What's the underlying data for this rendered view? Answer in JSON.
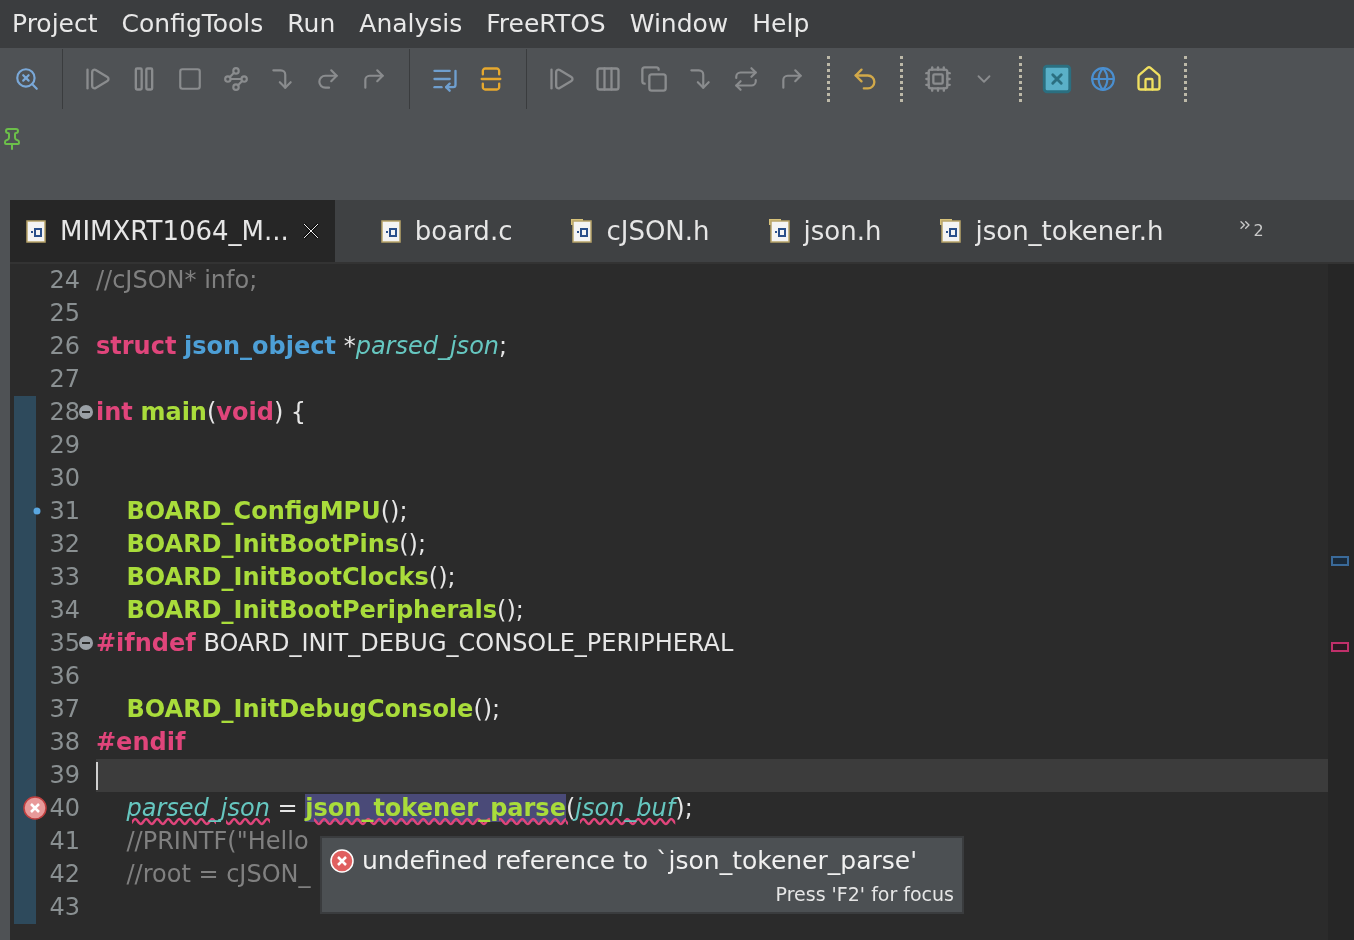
{
  "menu": [
    "Project",
    "ConfigTools",
    "Run",
    "Analysis",
    "FreeRTOS",
    "Window",
    "Help"
  ],
  "tabs": [
    {
      "label": "MIMXRT1064_M...",
      "kind": "c",
      "selected": true
    },
    {
      "label": "board.c",
      "kind": "c",
      "selected": false
    },
    {
      "label": "cJSON.h",
      "kind": "h",
      "selected": false
    },
    {
      "label": "json.h",
      "kind": "h",
      "selected": false
    },
    {
      "label": "json_tokener.h",
      "kind": "h",
      "selected": false
    }
  ],
  "tab_overflow": "2",
  "lines": [
    {
      "number": "24",
      "kind": "plain",
      "tokens": [
        {
          "kind": "comment",
          "text": "//cJSON* info;"
        }
      ]
    },
    {
      "number": "25",
      "kind": "plain"
    },
    {
      "number": "26",
      "kind": "plain",
      "tokens": [
        {
          "kind": "keyword",
          "text": "struct"
        },
        {
          "kind": "type",
          "text": " json_object"
        },
        {
          "kind": "plain",
          "text": " *"
        },
        {
          "kind": "var",
          "text": "parsed_json"
        },
        {
          "kind": "plain",
          "text": ";"
        }
      ]
    },
    {
      "number": "27",
      "kind": "plain"
    },
    {
      "number": "28",
      "kind": "fold",
      "tokens": [
        {
          "kind": "keyword",
          "text": "int"
        },
        {
          "kind": "func",
          "text": " main"
        },
        {
          "kind": "plain",
          "text": "("
        },
        {
          "kind": "keyword",
          "text": "void"
        },
        {
          "kind": "plain",
          "text": ") {"
        }
      ]
    },
    {
      "number": "29",
      "kind": "plain"
    },
    {
      "number": "30",
      "kind": "plain"
    },
    {
      "number": "31",
      "kind": "bookmark",
      "tokens": [
        {
          "kind": "func",
          "text": "    BOARD_ConfigMPU"
        },
        {
          "kind": "plain",
          "text": "();"
        }
      ]
    },
    {
      "number": "32",
      "kind": "plain",
      "tokens": [
        {
          "kind": "func",
          "text": "    BOARD_InitBootPins"
        },
        {
          "kind": "plain",
          "text": "();"
        }
      ]
    },
    {
      "number": "33",
      "kind": "plain",
      "tokens": [
        {
          "kind": "func",
          "text": "    BOARD_InitBootClocks"
        },
        {
          "kind": "plain",
          "text": "();"
        }
      ]
    },
    {
      "number": "34",
      "kind": "plain",
      "tokens": [
        {
          "kind": "func",
          "text": "    BOARD_InitBootPeripherals"
        },
        {
          "kind": "plain",
          "text": "();"
        }
      ]
    },
    {
      "number": "35",
      "kind": "fold",
      "tokens": [
        {
          "kind": "preproc",
          "text": "#ifndef"
        },
        {
          "kind": "plain",
          "text": " BOARD_INIT_DEBUG_CONSOLE_PERIPHERAL"
        }
      ]
    },
    {
      "number": "36",
      "kind": "plain"
    },
    {
      "number": "37",
      "kind": "plain",
      "tokens": [
        {
          "kind": "func",
          "text": "    BOARD_InitDebugConsole"
        },
        {
          "kind": "plain",
          "text": "();"
        }
      ]
    },
    {
      "number": "38",
      "kind": "plain",
      "tokens": [
        {
          "kind": "preproc",
          "text": "#endif"
        }
      ]
    },
    {
      "number": "39",
      "kind": "current"
    },
    {
      "number": "40",
      "kind": "error",
      "tokens": [
        {
          "kind": "var_error",
          "text": "    parsed_json"
        },
        {
          "kind": "plain",
          "text": " = "
        },
        {
          "kind": "func_highlight",
          "text": "json_tokener_parse"
        },
        {
          "kind": "plain_error",
          "text": "("
        },
        {
          "kind": "var_error",
          "text": "json_buf"
        },
        {
          "kind": "plain",
          "text": ");"
        }
      ]
    },
    {
      "number": "41",
      "kind": "plain",
      "tokens": [
        {
          "kind": "comment",
          "text": "    //PRINTF(\"Hello"
        }
      ]
    },
    {
      "number": "42",
      "kind": "plain",
      "tokens": [
        {
          "kind": "comment",
          "text": "    //root = cJSON_"
        }
      ]
    },
    {
      "number": "43",
      "kind": "plain"
    }
  ],
  "tooltip": {
    "message": "undefined reference to `json_tokener_parse'",
    "hint": "Press 'F2' for focus"
  }
}
